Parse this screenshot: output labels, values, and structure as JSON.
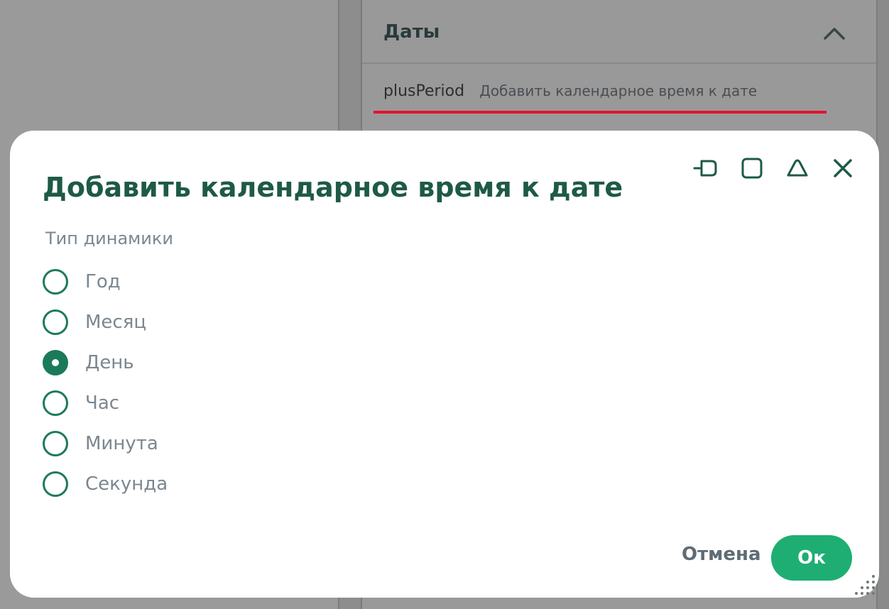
{
  "background": {
    "section": {
      "title": "Даты",
      "collapse_icon": "chevron-up-icon"
    },
    "function_row": {
      "name": "plusPeriod",
      "description": "Добавить календарное время к дате"
    }
  },
  "dialog": {
    "title": "Добавить календарное время к дате",
    "window_controls": [
      "pin-icon",
      "maximize-icon",
      "minimize-icon",
      "close-icon"
    ],
    "group_label": "Тип динамики",
    "options": [
      {
        "label": "Год",
        "checked": false
      },
      {
        "label": "Месяц",
        "checked": false
      },
      {
        "label": "День",
        "checked": true
      },
      {
        "label": "Час",
        "checked": false
      },
      {
        "label": "Минута",
        "checked": false
      },
      {
        "label": "Секунда",
        "checked": false
      }
    ],
    "cancel_label": "Отмена",
    "ok_label": "Ок"
  },
  "colors": {
    "accent_green": "#1eae73",
    "dark_green": "#1a7a5a",
    "title_green": "#1e5a46",
    "highlight_red": "#e3142f",
    "muted_text": "#7b8790"
  }
}
